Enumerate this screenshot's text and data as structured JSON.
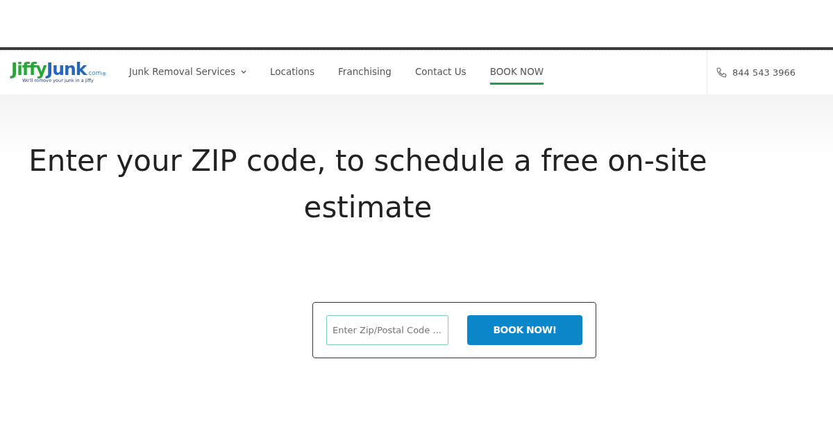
{
  "logo": {
    "word_1": "Jiffy",
    "word_2": "Junk",
    "suffix": ".com",
    "mark": "®",
    "tagline": "We'll remove your junk in a jiffy"
  },
  "nav": [
    {
      "label": "Junk Removal Services",
      "has_menu": true,
      "selected": false
    },
    {
      "label": "Locations",
      "has_menu": false,
      "selected": false
    },
    {
      "label": "Franchising",
      "has_menu": false,
      "selected": false
    },
    {
      "label": "Contact Us",
      "has_menu": false,
      "selected": false
    },
    {
      "label": "BOOK NOW",
      "has_menu": false,
      "selected": true
    }
  ],
  "phone": "844 543 3966",
  "heading": "Enter your ZIP code, to schedule a free on-site estimate",
  "form": {
    "placeholder": "Enter Zip/Postal Code ...",
    "button": "BOOK NOW!"
  }
}
